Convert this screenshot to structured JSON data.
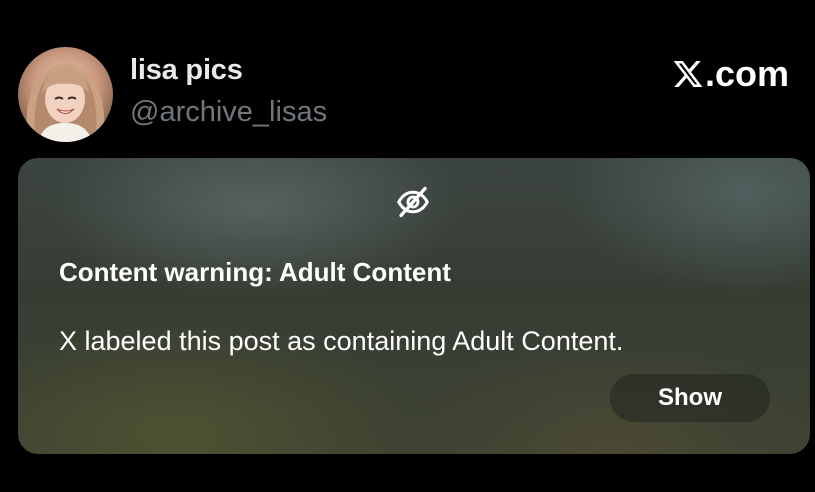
{
  "header": {
    "display_name": "lisa pics",
    "handle": "@archive_lisas",
    "brand_text": ".com",
    "brand_icon": "x-logo-icon"
  },
  "avatar": {
    "icon": "profile-avatar"
  },
  "warning": {
    "icon": "eye-off-icon",
    "title": "Content warning: Adult Content",
    "message": "X labeled this post as containing Adult Content.",
    "show_label": "Show"
  },
  "colors": {
    "background": "#000000",
    "name": "#e7e9ea",
    "handle": "#71767b",
    "button_bg": "#2a2e26"
  }
}
